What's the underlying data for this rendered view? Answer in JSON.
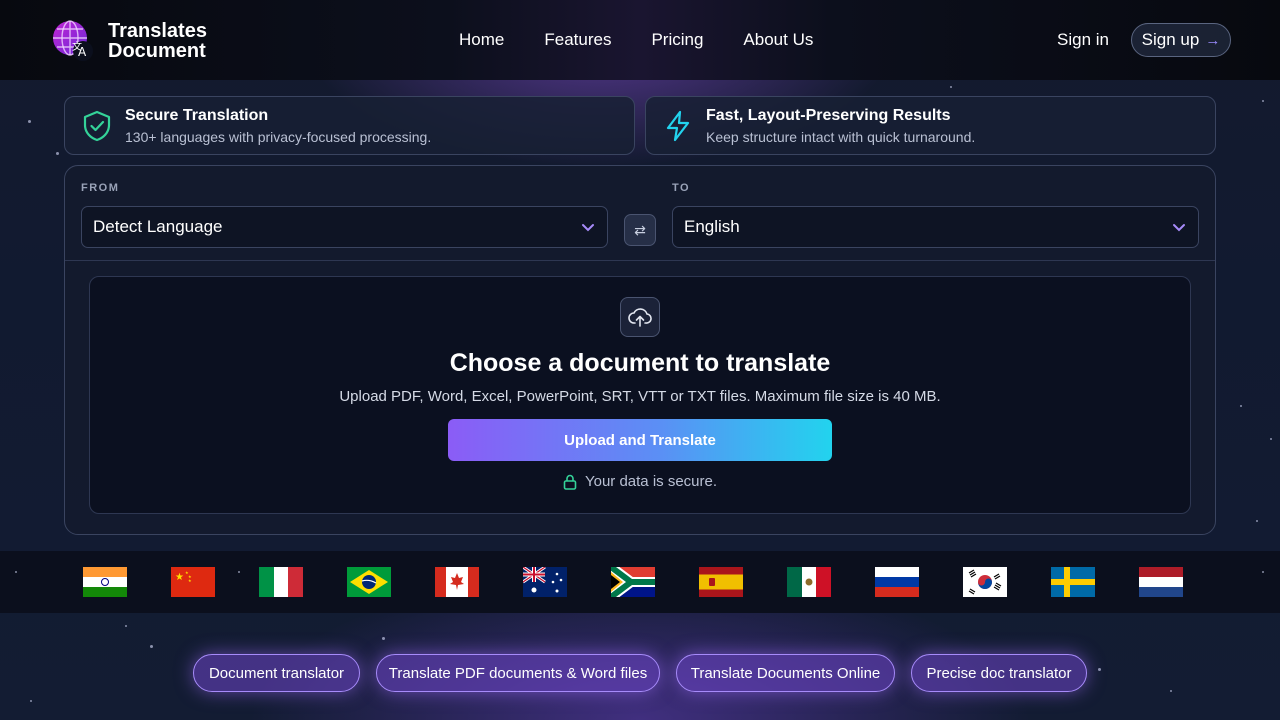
{
  "brand": {
    "line1": "Translates",
    "line2": "Document",
    "logo_icon": "globe-translate-icon"
  },
  "nav": {
    "items": [
      "Home",
      "Features",
      "Pricing",
      "About Us"
    ]
  },
  "auth": {
    "signin": "Sign in",
    "signup": "Sign up",
    "signup_arrow": "→"
  },
  "features": [
    {
      "title": "Secure Translation",
      "subtitle": "130+ languages with privacy-focused processing.",
      "icon": "shield-check-icon",
      "color": "#34d399"
    },
    {
      "title": "Fast, Layout-Preserving Results",
      "subtitle": "Keep structure intact with quick turnaround.",
      "icon": "lightning-icon",
      "color": "#22d3ee"
    }
  ],
  "translator": {
    "from_label": "FROM",
    "from_value": "Detect Language",
    "to_label": "TO",
    "to_value": "English",
    "swap_glyph": "⇄"
  },
  "dropzone": {
    "title": "Choose a document to translate",
    "subtitle": "Upload PDF, Word, Excel, PowerPoint, SRT, VTT or TXT files. Maximum file size is 40 MB.",
    "button": "Upload and Translate",
    "secure_text": "Your data is secure."
  },
  "flags": [
    "India",
    "China",
    "Italy",
    "Brazil",
    "Canada",
    "Australia",
    "South Africa",
    "Spain",
    "Mexico",
    "Russia",
    "South Korea",
    "Sweden",
    "Netherlands"
  ],
  "chips": [
    "Document translator",
    "Translate PDF documents & Word files",
    "Translate Documents Online",
    "Precise doc translator"
  ],
  "colors": {
    "accent_purple": "#8b5cf6",
    "accent_cyan": "#22d3ee",
    "secure_green": "#34d399"
  }
}
